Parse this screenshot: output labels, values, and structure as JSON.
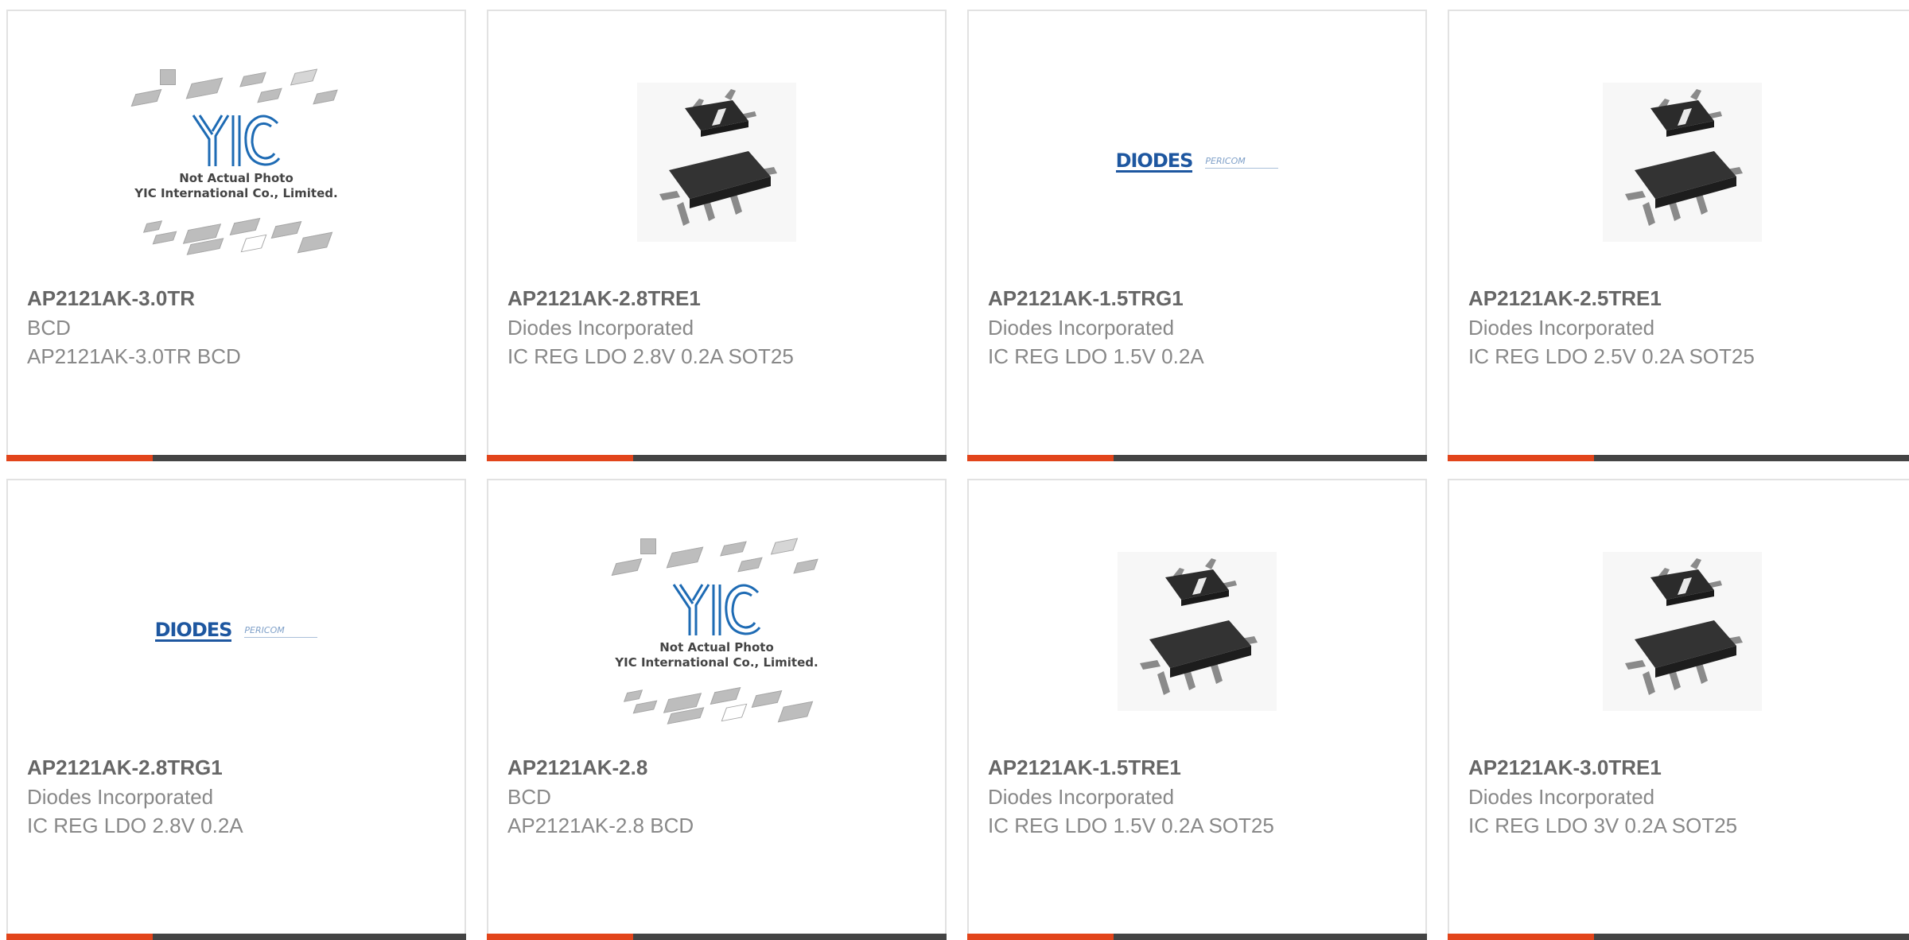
{
  "products": [
    {
      "part_number": "AP2121AK-3.0TR",
      "manufacturer": "BCD",
      "description": "AP2121AK-3.0TR BCD",
      "image": "yic-placeholder",
      "image_caption": [
        "Not Actual Photo",
        "YIC International Co., Limited."
      ]
    },
    {
      "part_number": "AP2121AK-2.8TRE1",
      "manufacturer": "Diodes Incorporated",
      "description": "IC REG LDO 2.8V 0.2A SOT25",
      "image": "sot25-package"
    },
    {
      "part_number": "AP2121AK-1.5TRG1",
      "manufacturer": "Diodes Incorporated",
      "description": "IC REG LDO 1.5V 0.2A",
      "image": "diodes-logo",
      "logo_text": "DIODES",
      "logo_secondary": "PERICOM"
    },
    {
      "part_number": "AP2121AK-2.5TRE1",
      "manufacturer": "Diodes Incorporated",
      "description": "IC REG LDO 2.5V 0.2A SOT25",
      "image": "sot25-package"
    },
    {
      "part_number": "AP2121AK-2.8TRG1",
      "manufacturer": "Diodes Incorporated",
      "description": "IC REG LDO 2.8V 0.2A",
      "image": "diodes-logo",
      "logo_text": "DIODES",
      "logo_secondary": "PERICOM"
    },
    {
      "part_number": "AP2121AK-2.8",
      "manufacturer": "BCD",
      "description": "AP2121AK-2.8 BCD",
      "image": "yic-placeholder",
      "image_caption": [
        "Not Actual Photo",
        "YIC International Co., Limited."
      ]
    },
    {
      "part_number": "AP2121AK-1.5TRE1",
      "manufacturer": "Diodes Incorporated",
      "description": "IC REG LDO 1.5V 0.2A SOT25",
      "image": "sot25-package"
    },
    {
      "part_number": "AP2121AK-3.0TRE1",
      "manufacturer": "Diodes Incorporated",
      "description": "IC REG LDO 3V 0.2A SOT25",
      "image": "sot25-package"
    }
  ],
  "colors": {
    "accent": "#e2451b",
    "bar": "#444444",
    "diodes_blue": "#1e57a0"
  }
}
